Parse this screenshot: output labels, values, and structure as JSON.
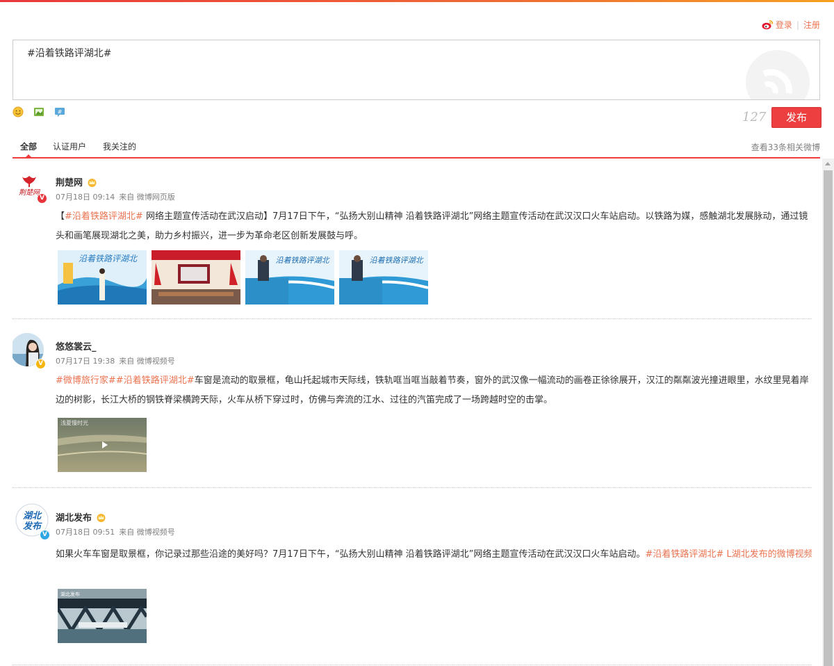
{
  "header": {
    "login_label": "登录",
    "register_label": "注册"
  },
  "composer": {
    "text": "#沿着铁路评湖北#",
    "counter": "127",
    "publish_label": "发布"
  },
  "tabs": {
    "items": [
      "全部",
      "认证用户",
      "我关注的"
    ],
    "more_label": "查看33条相关微博"
  },
  "posts": [
    {
      "user": "荆楚网",
      "time": "07月18日 09:14",
      "source": "来自 微博网页版",
      "pre": "【",
      "tag1": "#沿着铁路评湖北#",
      "body": " 网络主题宣传活动在武汉启动】7月17日下午，“弘扬大别山精神 沿着铁路评湖北”网络主题宣传活动在武汉汉口火车站启动。以铁路为媒，感触湖北发展脉动，通过镜头和画笔展现湖北之美，助力乡村振兴，进一步为革命老区创新发展鼓与呼。",
      "badge": "V"
    },
    {
      "user": "悠悠裳云_",
      "time": "07月17日 19:38",
      "source": "来自 微博视频号",
      "tag1": "#微博旅行家#",
      "tag2": "#沿着铁路评湖北#",
      "body": "车窗是流动的取景框，龟山托起城市天际线，铁轨哐当哐当敲着节奏，窗外的武汉像一幅流动的画卷正徐徐展开，汉江的粼粼波光撞进眼里，水纹里晃着岸边的树影，长江大桥的钢铁脊梁横跨天际，火车从桥下穿过时，仿佛与奔流的江水、过往的汽笛完成了一场跨越时空的击掌。",
      "badge": "V",
      "video_caption": "浅夏慢时光"
    },
    {
      "user": "湖北发布",
      "time": "07月18日 09:51",
      "source": "来自 微博视频号",
      "body": "如果火车车窗是取景框，你记录过那些沿途的美好吗？7月17日下午，“弘扬大别山精神 沿着铁路评湖北”网络主题宣传活动在武汉汉口火车站启动。",
      "tag1": "#沿着铁路评湖北#",
      "link": " L湖北发布的微博视频",
      "badge": "V",
      "avatar_text": "湖北发布",
      "video_caption": "湖北发布"
    }
  ],
  "avatar1_text": "荆楚网",
  "thumb_banner_text": "沿着铁路评湖北",
  "colors": {
    "accent": "#eb7350",
    "publish": "#ed3f3f",
    "tab_line": "#f03c3c"
  }
}
